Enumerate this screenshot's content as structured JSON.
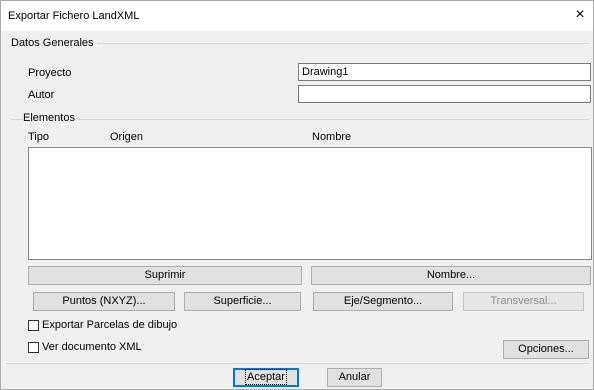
{
  "window": {
    "title": "Exportar Fichero LandXML",
    "close_glyph": "×"
  },
  "general": {
    "group_title": "Datos Generales",
    "proyecto_label": "Proyecto",
    "proyecto_value": "Drawing1",
    "autor_label": "Autor",
    "autor_value": ""
  },
  "elementos": {
    "group_title": "Elementos",
    "columns": [
      "Tipo",
      "Origen",
      "Nombre"
    ],
    "rows": []
  },
  "buttons": {
    "suprimir": "Suprimir",
    "nombre": "Nombre...",
    "puntos": "Puntos (NXYZ)...",
    "superficie": "Superficie...",
    "eje": "Eje/Segmento...",
    "transversal": "Transversal...",
    "opciones": "Opciones...",
    "aceptar": "Aceptar",
    "anular": "Anular"
  },
  "checkboxes": {
    "parcelas_label": "Exportar Parcelas de dibujo",
    "parcelas_checked": false,
    "ver_xml_label": "Ver documento XML",
    "ver_xml_checked": false
  }
}
